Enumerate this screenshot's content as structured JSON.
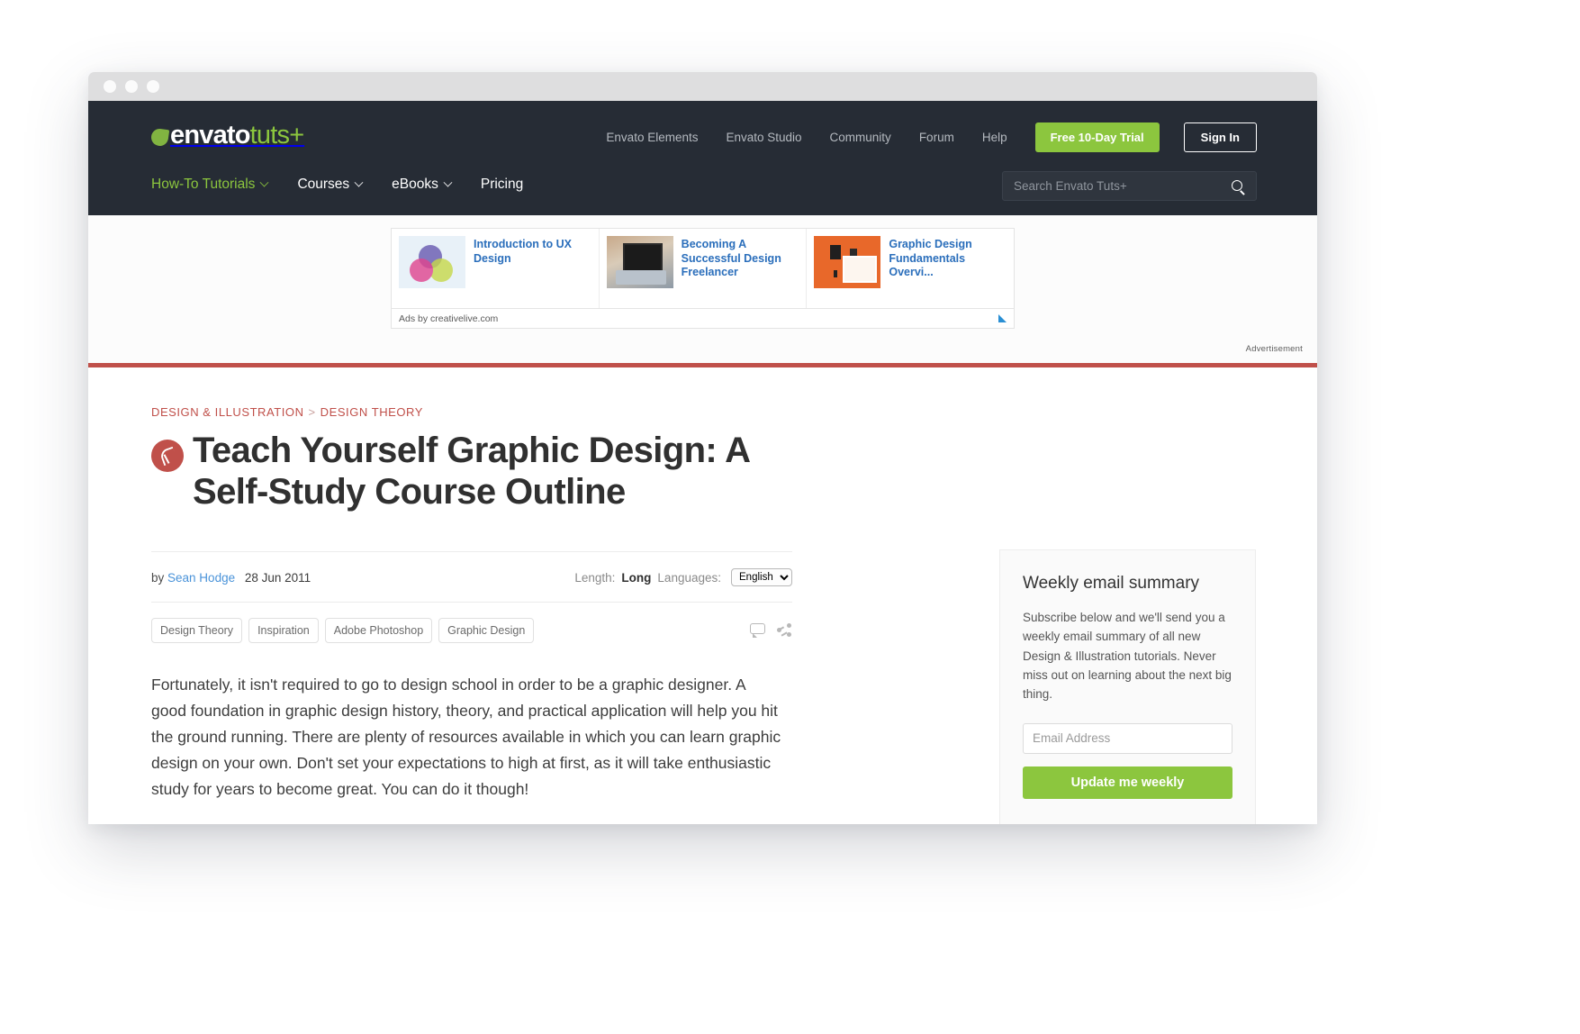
{
  "header": {
    "logo": {
      "part1": "envato",
      "part2": "tuts",
      "part3": "+"
    },
    "top_links": [
      "Envato Elements",
      "Envato Studio",
      "Community",
      "Forum",
      "Help"
    ],
    "trial_button": "Free 10-Day Trial",
    "signin_button": "Sign In",
    "main_nav": [
      {
        "label": "How-To Tutorials",
        "has_caret": true,
        "active": true
      },
      {
        "label": "Courses",
        "has_caret": true,
        "active": false
      },
      {
        "label": "eBooks",
        "has_caret": true,
        "active": false
      },
      {
        "label": "Pricing",
        "has_caret": false,
        "active": false
      }
    ],
    "search_placeholder": "Search Envato Tuts+"
  },
  "ad": {
    "items": [
      {
        "title": "Introduction to UX Design"
      },
      {
        "title": "Becoming A Successful Design Freelancer"
      },
      {
        "title": "Graphic Design Fundamentals Overvi..."
      }
    ],
    "attribution": "Ads by creativelive.com",
    "advertisement_label": "Advertisement"
  },
  "article": {
    "breadcrumb": {
      "parent": "DESIGN & ILLUSTRATION",
      "separator": ">",
      "child": "DESIGN THEORY"
    },
    "title": "Teach Yourself Graphic Design: A Self-Study Course Outline",
    "by_prefix": "by",
    "author": "Sean Hodge",
    "date": "28 Jun 2011",
    "length_label": "Length:",
    "length_value": "Long",
    "languages_label": "Languages:",
    "language_selected": "English",
    "language_options": [
      "English"
    ],
    "tags": [
      "Design Theory",
      "Inspiration",
      "Adobe Photoshop",
      "Graphic Design"
    ],
    "body": "Fortunately, it isn't required to go to design school in order to be a graphic designer. A good foundation in graphic design history, theory, and practical application will help you hit the ground running. There are plenty of resources available in which you can learn graphic design on your own. Don't set your expectations to high at first, as it will take enthusiastic study for years to become great. You can do it though!"
  },
  "sidebar": {
    "title": "Weekly email summary",
    "text": "Subscribe below and we'll send you a weekly email summary of all new Design & Illustration tutorials. Never miss out on learning about the next big thing.",
    "email_placeholder": "Email Address",
    "submit_label": "Update me weekly"
  },
  "colors": {
    "brand_green": "#8cc63e",
    "header_dark": "#262c35",
    "accent_red": "#c0504a",
    "link_blue": "#4a93d9",
    "ad_link_blue": "#2a6ebb"
  }
}
